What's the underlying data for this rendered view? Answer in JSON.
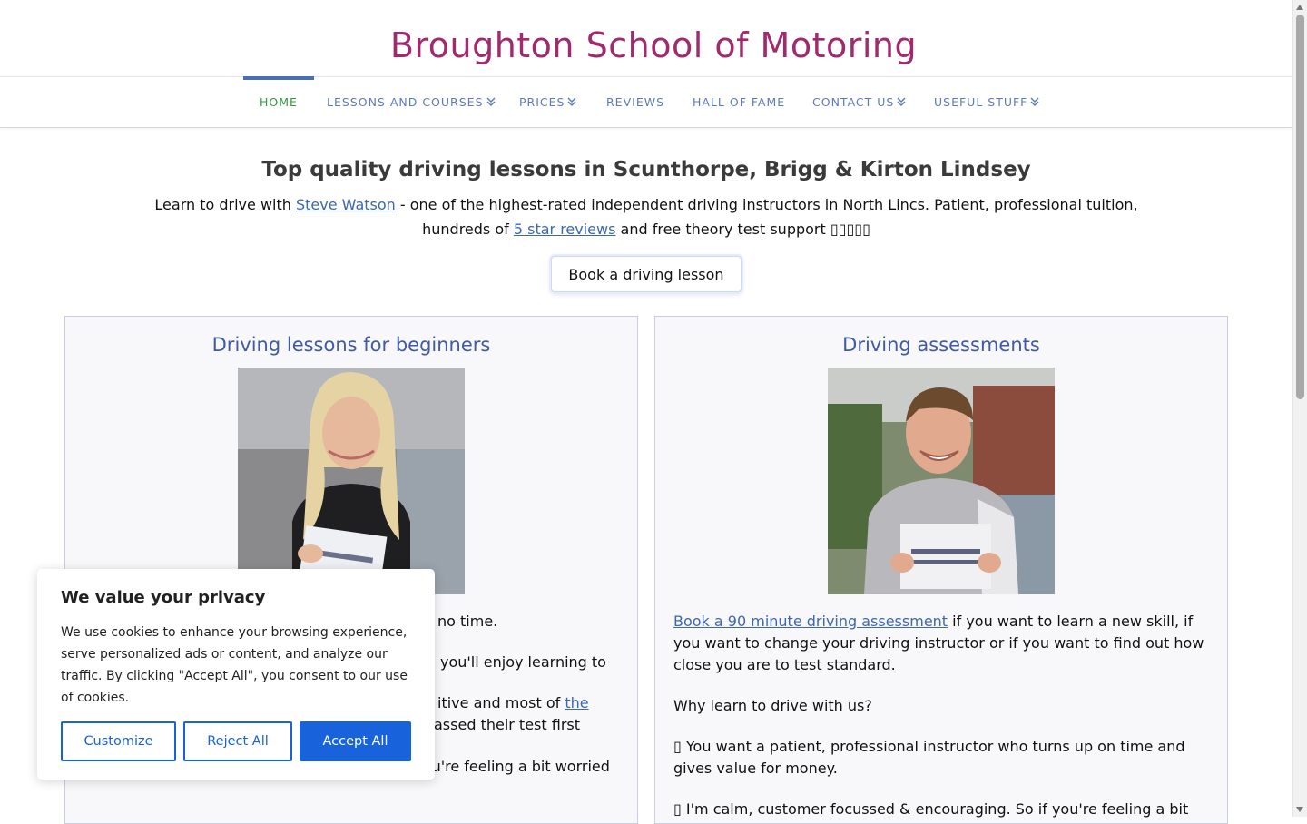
{
  "site": {
    "title": "Broughton School of Motoring"
  },
  "nav": {
    "items": [
      {
        "label": "HOME"
      },
      {
        "label": "LESSONS AND COURSES"
      },
      {
        "label": "PRICES"
      },
      {
        "label": "REVIEWS"
      },
      {
        "label": "HALL OF FAME"
      },
      {
        "label": "CONTACT US"
      },
      {
        "label": "USEFUL STUFF"
      }
    ]
  },
  "hero": {
    "heading": "Top quality driving lessons in Scunthorpe, Brigg & Kirton Lindsey",
    "text_1": "Learn to drive with ",
    "link_instructor": "Steve Watson",
    "text_2": " - one of the highest-rated independent driving instructors in North Lincs. Patient, professional tuition, hundreds of ",
    "link_reviews": "5 star reviews",
    "text_3": " and free theory test support ",
    "stars_glyphs": "▯▯▯▯▯",
    "cta": "Book a driving lesson"
  },
  "cards": {
    "beginners": {
      "title": "Driving lessons for beginners",
      "line_1": "no time.",
      "line_2": "you'll enjoy learning to",
      "line_3a": "itive and most of ",
      "line_3_link": "the",
      "line_4": "assed their test first",
      "line_5": "I'll help you pass your theory test too and if you're feeling a bit worried"
    },
    "assessments": {
      "title": "Driving assessments",
      "link_text": "Book a 90 minute driving assessment",
      "para_1_rest": " if you want to learn a new skill, if you want to change your driving instructor or if you want to find out how close you are to test standard.",
      "para_2": "Why learn to drive with us?",
      "bullet_glyph": "▯",
      "para_3": " You want a patient, professional instructor who turns up on time and gives value for money.",
      "para_4": " I'm calm, customer focussed & encouraging. So if you're feeling a bit"
    }
  },
  "cookie": {
    "title": "We value your privacy",
    "text": "We use cookies to enhance your browsing experience, serve personalized ads or content, and analyze our traffic. By clicking \"Accept All\", you consent to our use of cookies.",
    "customize": "Customize",
    "reject": "Reject All",
    "accept": "Accept All"
  },
  "colors": {
    "title": "#a02a6e",
    "nav_link": "#5b7bbf",
    "nav_active": "#2e9a3e",
    "card_title": "#3f5aa6",
    "link": "#3d67b5",
    "cookie_primary": "#1863dc"
  },
  "icons": {
    "nav_dropdown": "chevron-double-down-icon"
  }
}
